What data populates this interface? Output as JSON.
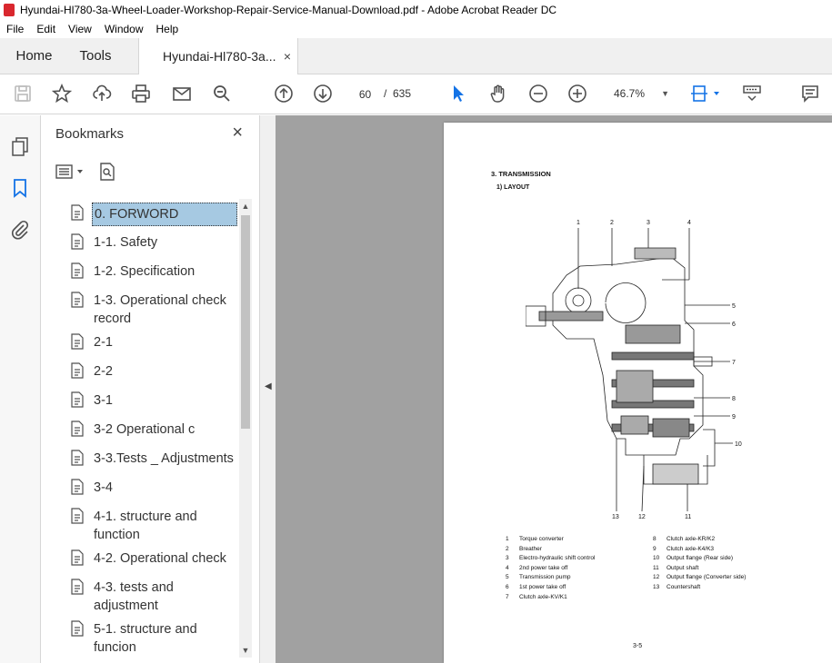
{
  "window": {
    "title": "Hyundai-Hl780-3a-Wheel-Loader-Workshop-Repair-Service-Manual-Download.pdf - Adobe Acrobat Reader DC"
  },
  "menu": [
    "File",
    "Edit",
    "View",
    "Window",
    "Help"
  ],
  "tabs": {
    "home": "Home",
    "tools": "Tools",
    "document": "Hyundai-Hl780-3a...",
    "close": "×"
  },
  "toolbar": {
    "page_current": "60",
    "page_sep": "/",
    "page_total": "635",
    "zoom": "46.7%"
  },
  "bookmarks": {
    "title": "Bookmarks",
    "close": "×",
    "items": [
      {
        "label": "0. FORWORD",
        "selected": true
      },
      {
        "label": "1-1. Safety"
      },
      {
        "label": "1-2. Specification"
      },
      {
        "label": "1-3. Operational check record"
      },
      {
        "label": "2-1"
      },
      {
        "label": "2-2"
      },
      {
        "label": "3-1"
      },
      {
        "label": "3-2 Operational c"
      },
      {
        "label": "3-3.Tests _ Adjustments"
      },
      {
        "label": "3-4"
      },
      {
        "label": "4-1. structure and function"
      },
      {
        "label": "4-2. Operational check"
      },
      {
        "label": "4-3. tests and adjustment"
      },
      {
        "label": "5-1. structure and funcion"
      }
    ]
  },
  "document": {
    "heading": "3. TRANSMISSION",
    "subheading": "1) LAYOUT",
    "callouts": [
      "1",
      "2",
      "3",
      "4",
      "5",
      "6",
      "7",
      "8",
      "9",
      "10",
      "11",
      "12",
      "13"
    ],
    "legend_left": [
      {
        "n": "1",
        "t": "Torque converter"
      },
      {
        "n": "2",
        "t": "Breather"
      },
      {
        "n": "3",
        "t": "Electro-hydraulic shift control"
      },
      {
        "n": "4",
        "t": "2nd power take off"
      },
      {
        "n": "5",
        "t": "Transmission pump"
      },
      {
        "n": "6",
        "t": "1st power take off"
      },
      {
        "n": "7",
        "t": "Clutch axle-KV/K1"
      }
    ],
    "legend_right": [
      {
        "n": "8",
        "t": "Clutch axle-KR/K2"
      },
      {
        "n": "9",
        "t": "Clutch axle-K4/K3"
      },
      {
        "n": "10",
        "t": "Output flange (Rear side)"
      },
      {
        "n": "11",
        "t": "Output shaft"
      },
      {
        "n": "12",
        "t": "Output flange (Converter side)"
      },
      {
        "n": "13",
        "t": "Countershaft"
      }
    ],
    "page_number": "3-5"
  }
}
